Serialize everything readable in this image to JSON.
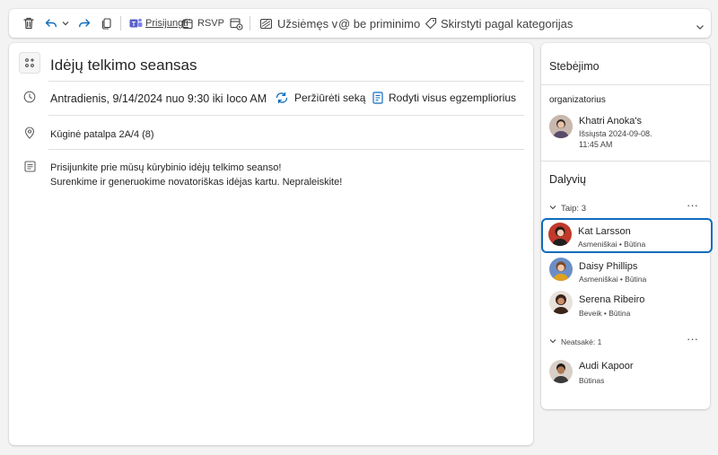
{
  "toolbar": {
    "join_label": "Prisijungti",
    "rsvp_label": "RSVP",
    "busy_label": "Užsiėmęs v",
    "reminder_label": "@ be priminimo",
    "categorize_label": "Skirstyti pagal kategorijas"
  },
  "event": {
    "title": "Idėjų telkimo seansas",
    "datetime": "Antradienis, 9/14/2024 nuo 9:30 iki Ioco AM",
    "view_series_label": "Peržiūrėti seką",
    "show_all_label": "Rodyti visus egzempliorius",
    "location": "Kūginė patalpa 2A/4 (8)",
    "description_line1": "Prisijunkite prie mūsų kūrybinio idėjų telkimo seanso!",
    "description_line2": "Surenkime ir generuokime novatoriškas idėjas kartu. Nepraleiskite!"
  },
  "sidebar": {
    "tracking_title": "Stebėjimo",
    "organizer_label": "organizatorius",
    "organizer": {
      "name": "Khatri Anoka's",
      "sent_line1": "Išsiųsta 2024-09-08.",
      "sent_line2": "11:45 AM"
    },
    "participants_title": "Dalyvių",
    "yes_group": {
      "label": "Taip: 3",
      "more": "···",
      "attendees": [
        {
          "name": "Kat Larsson",
          "sub": "Asmeniškai • Būtina"
        },
        {
          "name": "Daisy Phillips",
          "sub": "Asmeniškai • Būtina"
        },
        {
          "name": "Serena Ribeiro",
          "sub": "Beveik • Būtina"
        }
      ]
    },
    "no_response_group": {
      "label": "Neatsakė: 1",
      "more": "···",
      "attendees": [
        {
          "name": "Audi Kapoor",
          "sub": "Būtinas"
        }
      ]
    }
  },
  "colors": {
    "accent": "#0f6cbd",
    "teams_purple": "#5b5fc7",
    "panel_bg": "#ffffff",
    "page_bg": "#f3f3f3"
  }
}
